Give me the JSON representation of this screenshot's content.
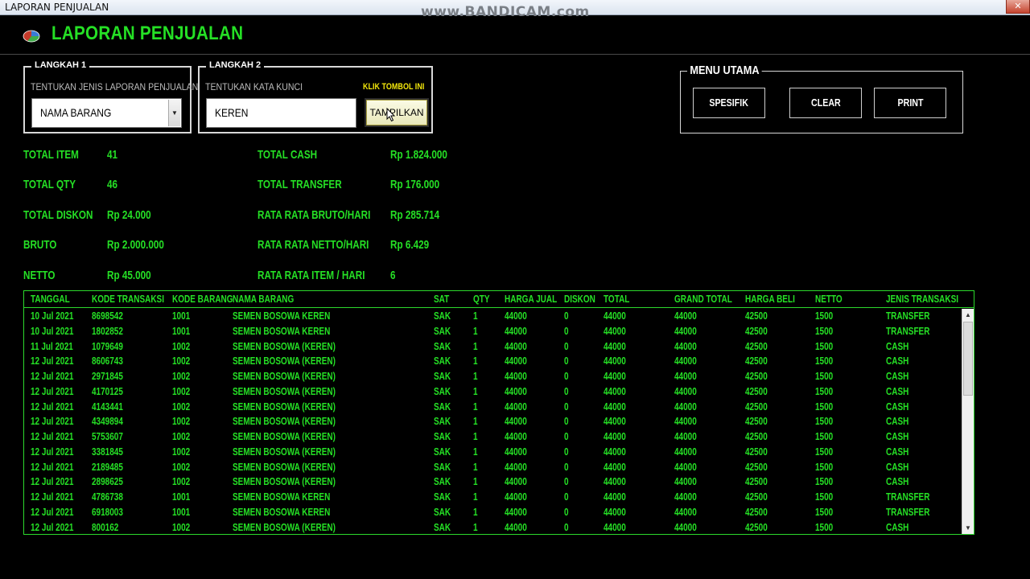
{
  "window": {
    "title": "LAPORAN PENJUALAN",
    "watermark": "www.BANDICAM.com",
    "close_glyph": "✕"
  },
  "app": {
    "title": "LAPORAN PENJUALAN",
    "logo_icon": "pie-chart-icon"
  },
  "langkah1": {
    "title": "LANGKAH 1",
    "hint": "TENTUKAN JENIS LAPORAN PENJUALAN",
    "selected": "NAMA BARANG",
    "arrow": "▼"
  },
  "langkah2": {
    "title": "LANGKAH 2",
    "hint": "TENTUKAN KATA KUNCI",
    "keyword": "KEREN",
    "klik_hint": "KLIK TOMBOL INI",
    "button": "TAMPILKAN"
  },
  "menu": {
    "title": "MENU UTAMA",
    "spesifik": "SPESIFIK",
    "clear": "CLEAR",
    "print": "PRINT"
  },
  "stats": {
    "total_item_label": "TOTAL ITEM",
    "total_item": "41",
    "total_qty_label": "TOTAL QTY",
    "total_qty": "46",
    "total_diskon_label": "TOTAL DISKON",
    "total_diskon": "Rp 24.000",
    "bruto_label": "BRUTO",
    "bruto": "Rp 2.000.000",
    "netto_label": "NETTO",
    "netto": "Rp 45.000",
    "total_cash_label": "TOTAL CASH",
    "total_cash": "Rp 1.824.000",
    "total_transfer_label": "TOTAL TRANSFER",
    "total_transfer": "Rp 176.000",
    "rata_bruto_label": "RATA RATA BRUTO/HARI",
    "rata_bruto": "Rp 285.714",
    "rata_netto_label": "RATA RATA NETTO/HARI",
    "rata_netto": "Rp 6.429",
    "rata_item_label": "RATA RATA ITEM / HARI",
    "rata_item": "6"
  },
  "table": {
    "columns": [
      "TANGGAL",
      "KODE TRANSAKSI",
      "KODE BARANG",
      "NAMA BARANG",
      "SAT",
      "QTY",
      "HARGA JUAL",
      "DISKON",
      "TOTAL",
      "GRAND TOTAL",
      "HARGA BELI",
      "NETTO",
      "JENIS TRANSAKSI"
    ],
    "rows": [
      [
        "10 Jul 2021",
        "8698542",
        "1001",
        "SEMEN BOSOWA KEREN",
        "SAK",
        "1",
        "44000",
        "0",
        "44000",
        "44000",
        "42500",
        "1500",
        "TRANSFER"
      ],
      [
        "10 Jul 2021",
        "1802852",
        "1001",
        "SEMEN BOSOWA KEREN",
        "SAK",
        "1",
        "44000",
        "0",
        "44000",
        "44000",
        "42500",
        "1500",
        "TRANSFER"
      ],
      [
        "11 Jul 2021",
        "1079649",
        "1002",
        "SEMEN BOSOWA (KEREN)",
        "SAK",
        "1",
        "44000",
        "0",
        "44000",
        "44000",
        "42500",
        "1500",
        "CASH"
      ],
      [
        "12 Jul 2021",
        "8606743",
        "1002",
        "SEMEN BOSOWA (KEREN)",
        "SAK",
        "1",
        "44000",
        "0",
        "44000",
        "44000",
        "42500",
        "1500",
        "CASH"
      ],
      [
        "12 Jul 2021",
        "2971845",
        "1002",
        "SEMEN BOSOWA (KEREN)",
        "SAK",
        "1",
        "44000",
        "0",
        "44000",
        "44000",
        "42500",
        "1500",
        "CASH"
      ],
      [
        "12 Jul 2021",
        "4170125",
        "1002",
        "SEMEN BOSOWA (KEREN)",
        "SAK",
        "1",
        "44000",
        "0",
        "44000",
        "44000",
        "42500",
        "1500",
        "CASH"
      ],
      [
        "12 Jul 2021",
        "4143441",
        "1002",
        "SEMEN BOSOWA (KEREN)",
        "SAK",
        "1",
        "44000",
        "0",
        "44000",
        "44000",
        "42500",
        "1500",
        "CASH"
      ],
      [
        "12 Jul 2021",
        "4349894",
        "1002",
        "SEMEN BOSOWA (KEREN)",
        "SAK",
        "1",
        "44000",
        "0",
        "44000",
        "44000",
        "42500",
        "1500",
        "CASH"
      ],
      [
        "12 Jul 2021",
        "5753607",
        "1002",
        "SEMEN BOSOWA (KEREN)",
        "SAK",
        "1",
        "44000",
        "0",
        "44000",
        "44000",
        "42500",
        "1500",
        "CASH"
      ],
      [
        "12 Jul 2021",
        "3381845",
        "1002",
        "SEMEN BOSOWA (KEREN)",
        "SAK",
        "1",
        "44000",
        "0",
        "44000",
        "44000",
        "42500",
        "1500",
        "CASH"
      ],
      [
        "12 Jul 2021",
        "2189485",
        "1002",
        "SEMEN BOSOWA (KEREN)",
        "SAK",
        "1",
        "44000",
        "0",
        "44000",
        "44000",
        "42500",
        "1500",
        "CASH"
      ],
      [
        "12 Jul 2021",
        "2898625",
        "1002",
        "SEMEN BOSOWA (KEREN)",
        "SAK",
        "1",
        "44000",
        "0",
        "44000",
        "44000",
        "42500",
        "1500",
        "CASH"
      ],
      [
        "12 Jul 2021",
        "4786738",
        "1001",
        "SEMEN BOSOWA KEREN",
        "SAK",
        "1",
        "44000",
        "0",
        "44000",
        "44000",
        "42500",
        "1500",
        "TRANSFER"
      ],
      [
        "12 Jul 2021",
        "6918003",
        "1001",
        "SEMEN BOSOWA KEREN",
        "SAK",
        "1",
        "44000",
        "0",
        "44000",
        "44000",
        "42500",
        "1500",
        "TRANSFER"
      ],
      [
        "12 Jul 2021",
        "800162",
        "1002",
        "SEMEN BOSOWA (KEREN)",
        "SAK",
        "1",
        "44000",
        "0",
        "44000",
        "44000",
        "42500",
        "1500",
        "CASH"
      ]
    ],
    "scroll_up": "▲",
    "scroll_down": "▼"
  },
  "colors": {
    "accent_green": "#25e025",
    "highlight_yellow": "#f2e60b"
  }
}
